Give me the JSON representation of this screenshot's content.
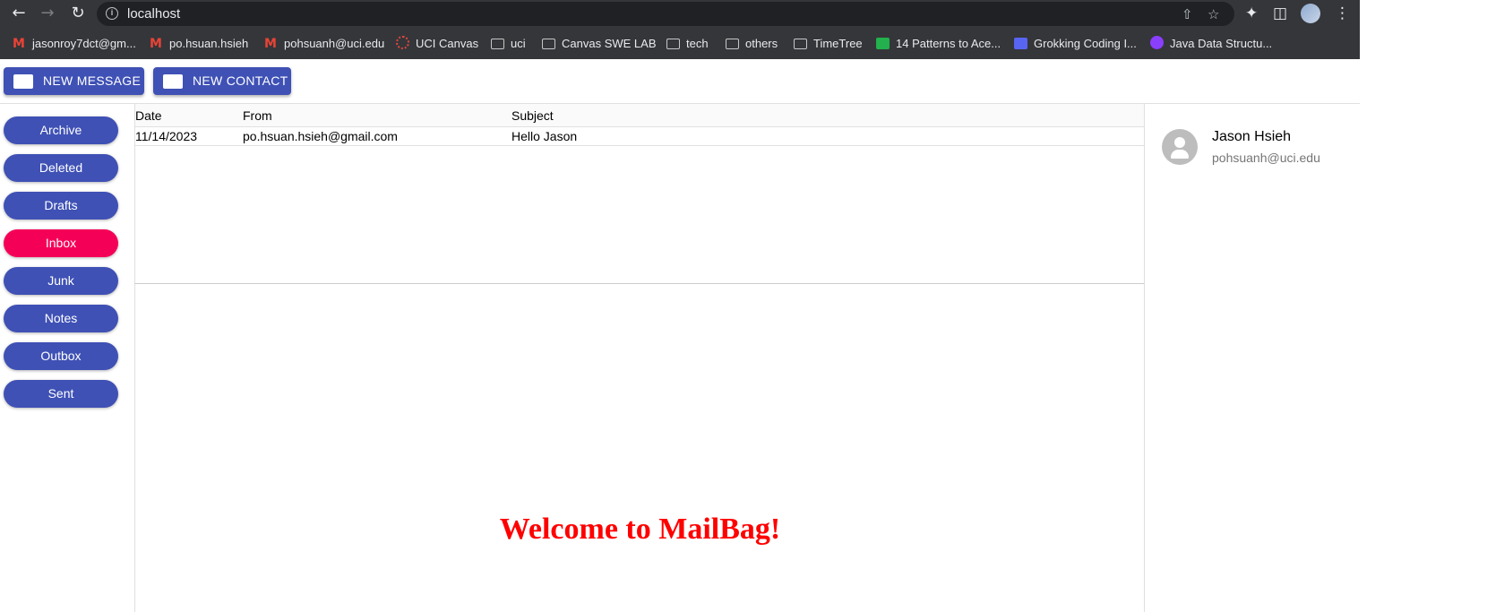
{
  "browser": {
    "url": "localhost",
    "bookmarks": [
      {
        "label": "jasonroy7dct@gm...",
        "icon": "gmail-icon"
      },
      {
        "label": "po.hsuan.hsieh",
        "icon": "gmail-icon"
      },
      {
        "label": "pohsuanh@uci.edu",
        "icon": "gmail-icon"
      },
      {
        "label": "UCI Canvas",
        "icon": "canvas-icon"
      },
      {
        "label": "uci",
        "icon": "folder-icon"
      },
      {
        "label": "Canvas SWE LAB",
        "icon": "folder-icon"
      },
      {
        "label": "tech",
        "icon": "folder-icon"
      },
      {
        "label": "others",
        "icon": "folder-icon"
      },
      {
        "label": "TimeTree",
        "icon": "folder-icon"
      },
      {
        "label": "14 Patterns to Ace...",
        "icon": "clock-icon"
      },
      {
        "label": "Grokking Coding I...",
        "icon": "terminal-icon"
      },
      {
        "label": "Java Data Structu...",
        "icon": "java-icon"
      }
    ]
  },
  "toolbar": {
    "new_message": "NEW MESSAGE",
    "new_contact": "NEW CONTACT"
  },
  "mailboxes": [
    {
      "label": "Archive",
      "active": false
    },
    {
      "label": "Deleted",
      "active": false
    },
    {
      "label": "Drafts",
      "active": false
    },
    {
      "label": "Inbox",
      "active": true
    },
    {
      "label": "Junk",
      "active": false
    },
    {
      "label": "Notes",
      "active": false
    },
    {
      "label": "Outbox",
      "active": false
    },
    {
      "label": "Sent",
      "active": false
    }
  ],
  "message_list": {
    "columns": [
      "Date",
      "From",
      "Subject"
    ],
    "rows": [
      {
        "date": "11/14/2023",
        "from": "po.hsuan.hsieh@gmail.com",
        "subject": "Hello Jason"
      }
    ]
  },
  "welcome_text": "Welcome to MailBag!",
  "contacts": [
    {
      "name": "Jason Hsieh",
      "email": "pohsuanh@uci.edu"
    }
  ],
  "colors": {
    "primary": "#3f51b5",
    "accent": "#f50057",
    "welcome": "#ff0000"
  }
}
